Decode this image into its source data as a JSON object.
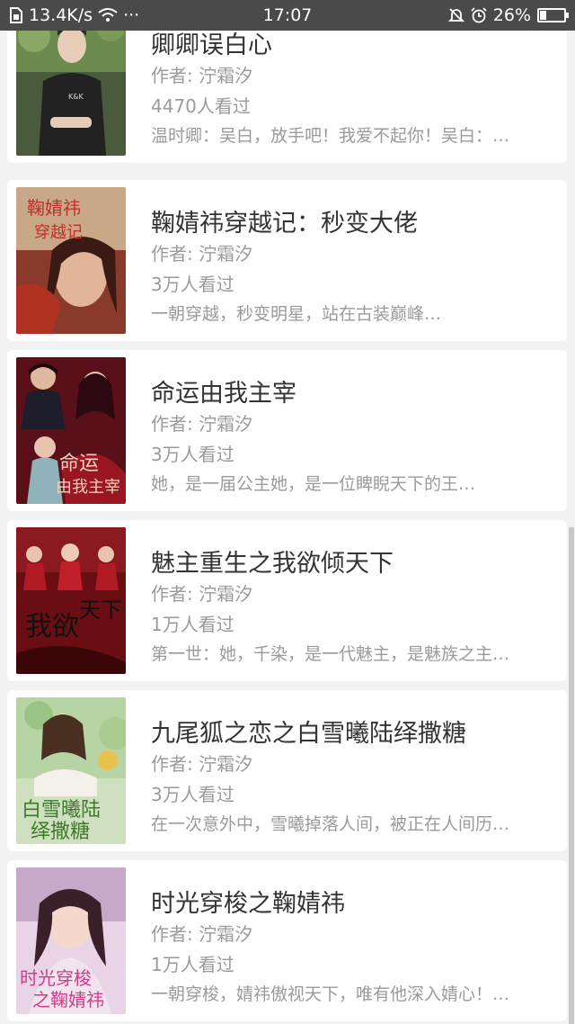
{
  "status_bar": {
    "network_speed": "13.4K/s",
    "more": "···",
    "time": "17:07",
    "battery": "26%",
    "battery_level": 0.26
  },
  "books": [
    {
      "title": "卿卿误白心",
      "author": "作者: 泞霜汐",
      "views": "4470人看过",
      "desc": "温时卿：吴白，放手吧！我爱不起你！吴白：…"
    },
    {
      "title": "鞠婧祎穿越记：秒变大佬",
      "author": "作者: 泞霜汐",
      "views": "3万人看过",
      "desc": "一朝穿越，秒变明星，站在古装巅峰…"
    },
    {
      "title": "命运由我主宰",
      "author": "作者: 泞霜汐",
      "views": "3万人看过",
      "desc": "她，是一届公主她，是一位睥睨天下的王…"
    },
    {
      "title": "魅主重生之我欲倾天下",
      "author": "作者: 泞霜汐",
      "views": "1万人看过",
      "desc": "第一世：她，千染，是一代魅主，是魅族之主…"
    },
    {
      "title": "九尾狐之恋之白雪曦陆绎撒糖",
      "author": "作者: 泞霜汐",
      "views": "3万人看过",
      "desc": "在一次意外中，雪曦掉落人间，被正在人间历…"
    },
    {
      "title": "时光穿梭之鞠婧祎",
      "author": "作者: 泞霜汐",
      "views": "1万人看过",
      "desc": "一朝穿梭，婧祎傲视天下，唯有他深入婧心！…"
    }
  ]
}
